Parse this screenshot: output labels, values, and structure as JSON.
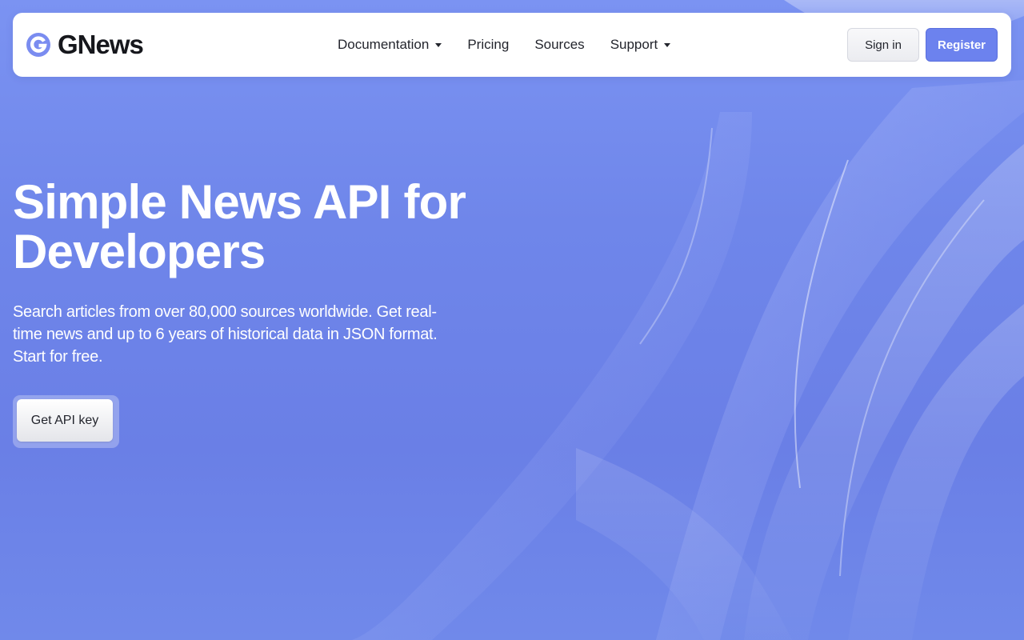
{
  "brand": {
    "name": "GNews",
    "logo_icon": "gnews-g-logo-icon"
  },
  "nav": {
    "items": [
      {
        "label": "Documentation",
        "has_dropdown": true
      },
      {
        "label": "Pricing",
        "has_dropdown": false
      },
      {
        "label": "Sources",
        "has_dropdown": false
      },
      {
        "label": "Support",
        "has_dropdown": true
      }
    ],
    "signin_label": "Sign in",
    "register_label": "Register"
  },
  "hero": {
    "title_line1": "Simple News API for",
    "title_line2": "Developers",
    "subtitle": "Search articles from over 80,000 sources worldwide. Get real-time news and up to 6 years of historical data in JSON format. Start for free.",
    "cta_label": "Get API key"
  },
  "colors": {
    "background": "#7089ea",
    "accent": "#6c82ee",
    "navbar": "#ffffff",
    "text_dark": "#16171c"
  }
}
